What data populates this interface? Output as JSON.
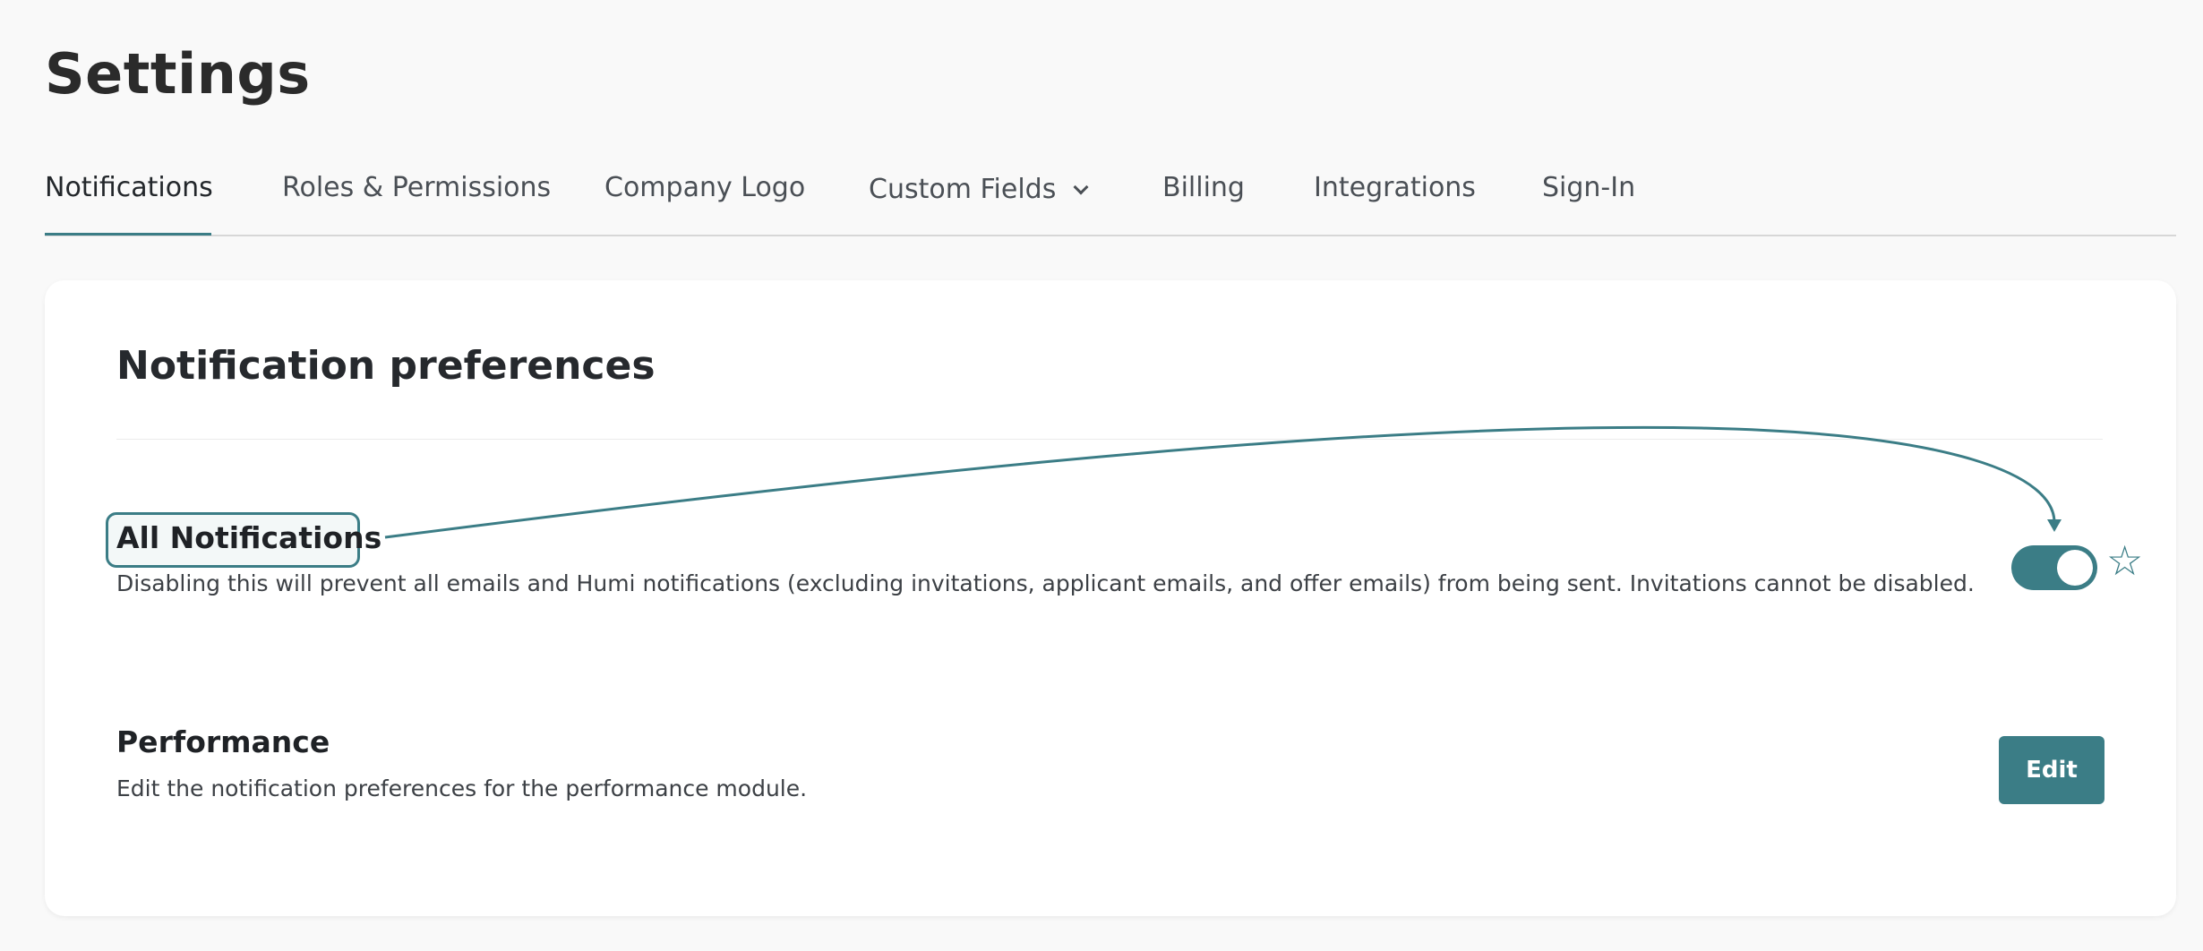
{
  "header": {
    "title": "Settings"
  },
  "tabs": [
    {
      "label": "Notifications",
      "active": true
    },
    {
      "label": "Roles & Permissions"
    },
    {
      "label": "Company Logo"
    },
    {
      "label": "Custom Fields",
      "has_dropdown": true
    },
    {
      "label": "Billing"
    },
    {
      "label": "Integrations"
    },
    {
      "label": "Sign-In"
    }
  ],
  "card": {
    "title": "Notification preferences",
    "all_notifications": {
      "label": "All Notifications",
      "description": "Disabling this will prevent all emails and Humi notifications (excluding invitations, applicant emails, and offer emails) from being sent. Invitations cannot be disabled.",
      "toggle_on": true
    },
    "performance": {
      "label": "Performance",
      "description": "Edit the notification preferences for the performance module.",
      "button_label": "Edit"
    }
  },
  "colors": {
    "accent": "#3b7d86",
    "background": "#f9f9f9",
    "card": "#ffffff"
  },
  "icons": {
    "tab_dropdown": "chevron-down-icon",
    "favorite": "star-icon"
  }
}
